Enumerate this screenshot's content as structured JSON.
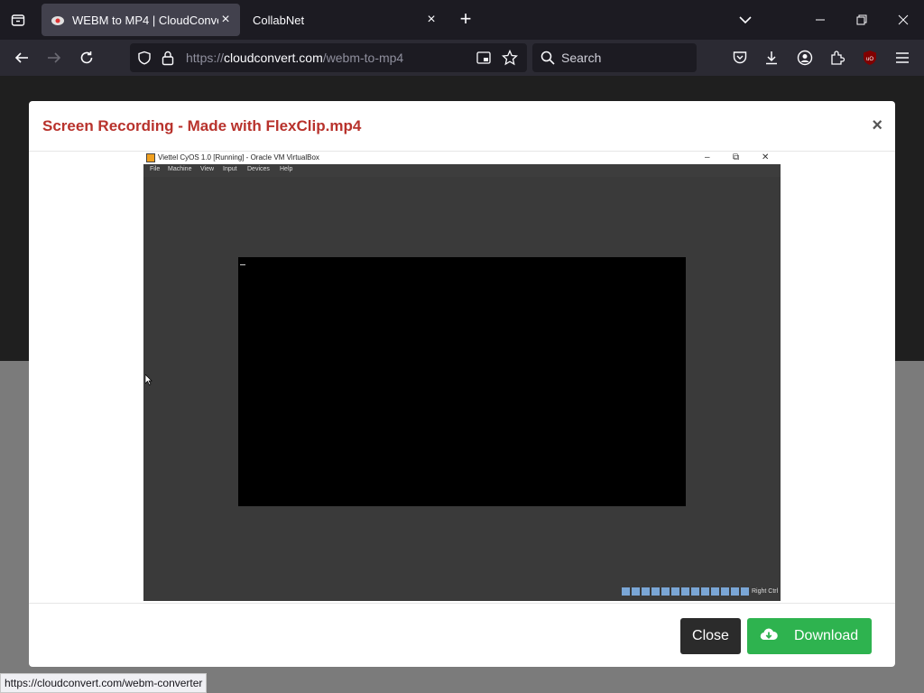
{
  "browser": {
    "tabs": [
      {
        "title": "WEBM to MP4 | CloudConvert",
        "active": true
      },
      {
        "title": "CollabNet",
        "active": false
      }
    ],
    "url_prefix": "https://",
    "url_host": "cloudconvert.com",
    "url_path": "/webm-to-mp4",
    "search_placeholder": "Search",
    "status_url": "https://cloudconvert.com/webm-converter"
  },
  "modal": {
    "title": "Screen Recording - Made with FlexClip.mp4",
    "close_x": "×",
    "close_label": "Close",
    "download_label": "Download"
  },
  "video": {
    "window_title": "Viettel CyOS 1.0 [Running] - Oracle VM VirtualBox",
    "menu": [
      "File",
      "Machine",
      "View",
      "Input",
      "Devices",
      "Help"
    ],
    "host_key": "Right Ctrl"
  },
  "colors": {
    "modal_title": "#b8322c",
    "download_button": "#2eb34f",
    "close_button": "#2b2b2b"
  }
}
